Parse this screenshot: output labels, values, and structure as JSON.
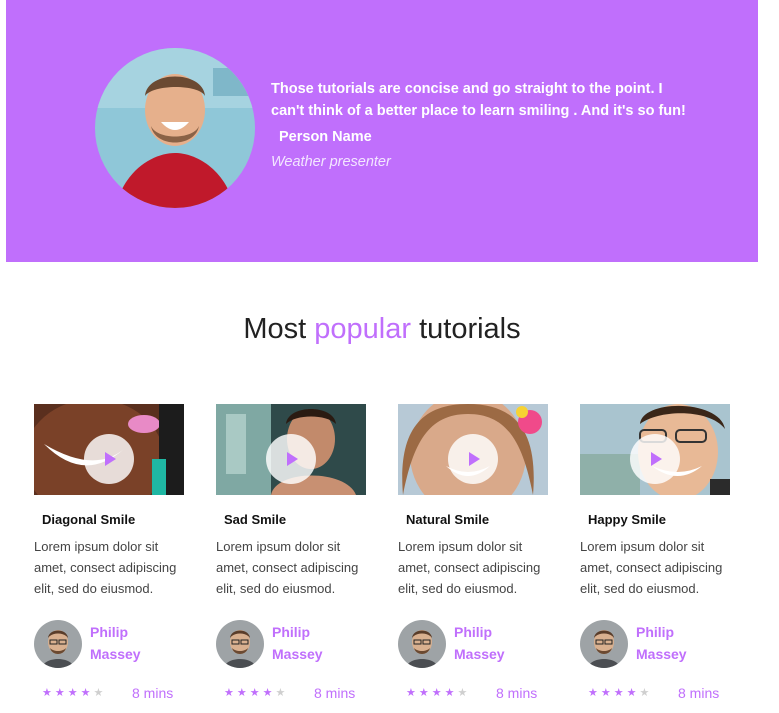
{
  "testimonial": {
    "quote": "Those tutorials are concise and go straight to the point. I can't think of a better place to learn smiling . And it's so fun!",
    "name": "Person Name",
    "role": "Weather presenter"
  },
  "section": {
    "title_before": "Most ",
    "title_accent": "popular",
    "title_after": " tutorials"
  },
  "cards": [
    {
      "title": "Diagonal Smile",
      "description": "Lorem ipsum dolor sit amet, consect adipiscing elit, sed do eiusmod.",
      "author_first": "Philip",
      "author_last": "Massey",
      "rating": 4,
      "duration": "8 mins"
    },
    {
      "title": "Sad Smile",
      "description": "Lorem ipsum dolor sit amet, consect adipiscing elit, sed do eiusmod.",
      "author_first": "Philip",
      "author_last": "Massey",
      "rating": 4,
      "duration": "8 mins"
    },
    {
      "title": "Natural Smile",
      "description": "Lorem ipsum dolor sit amet, consect adipiscing elit, sed do eiusmod.",
      "author_first": "Philip",
      "author_last": "Massey",
      "rating": 4,
      "duration": "8 mins"
    },
    {
      "title": "Happy Smile",
      "description": "Lorem ipsum dolor sit amet, consect adipiscing elit, sed do eiusmod.",
      "author_first": "Philip",
      "author_last": "Massey",
      "rating": 4,
      "duration": "8 mins"
    }
  ],
  "colors": {
    "accent": "#c06ffc",
    "star_empty": "#cfcfcf"
  },
  "icons": {
    "play": "play-icon",
    "star": "star-icon"
  }
}
